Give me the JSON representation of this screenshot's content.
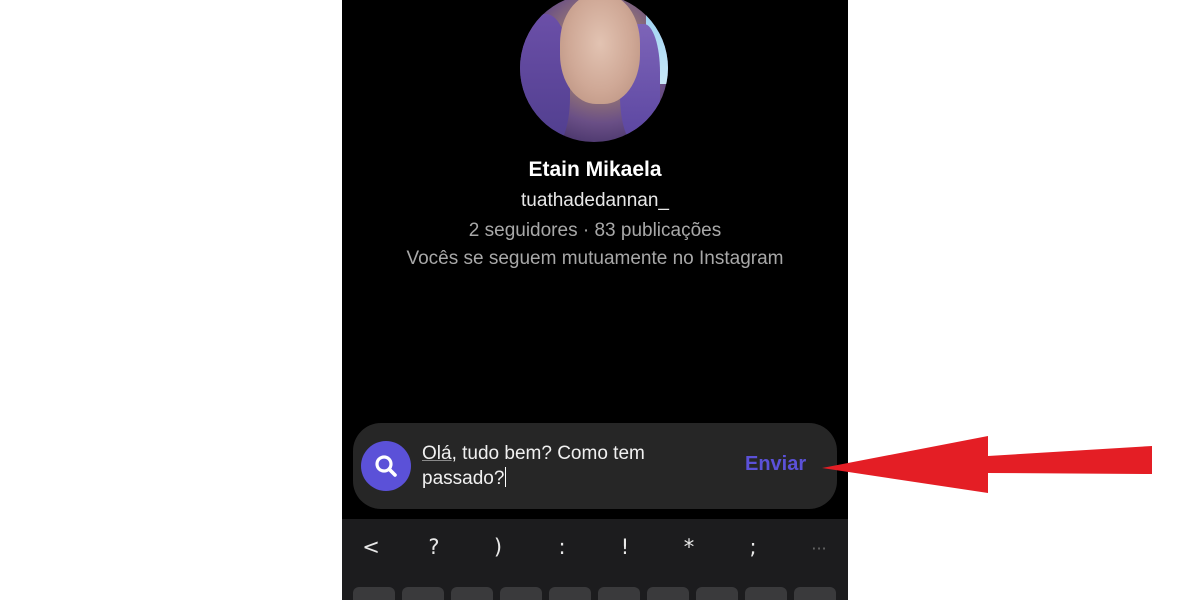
{
  "profile": {
    "name": "Etain Mikaela",
    "username": "tuathadedannan_",
    "stats": "2 seguidores · 83 publicações",
    "mutual_note": "Vocês se seguem mutuamente no Instagram"
  },
  "composer": {
    "icon": "search-icon",
    "message_underlined": "Olá",
    "message_rest": ", tudo bem? Como tem passado?",
    "send_label": "Enviar"
  },
  "keyboard": {
    "toolbar_keys": [
      "<",
      "?",
      ")",
      ":",
      "!",
      "*",
      ";",
      "···"
    ]
  },
  "colors": {
    "background": "#000000",
    "accent": "#5b51d8",
    "composer_bg": "#262626",
    "annotation_arrow": "#e41e25"
  }
}
